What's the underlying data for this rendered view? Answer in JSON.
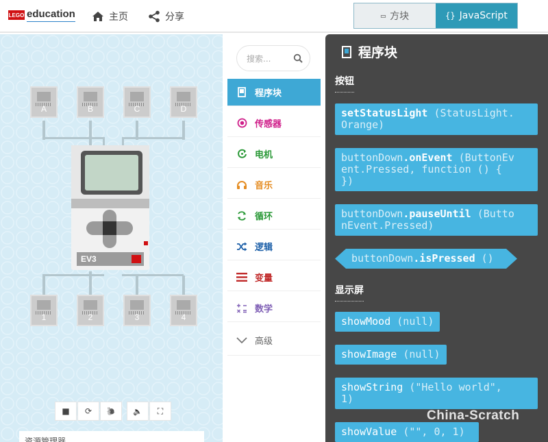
{
  "header": {
    "logo_badge": "LEGO",
    "logo_text": "education",
    "nav": [
      {
        "label": "主页",
        "icon": "home-icon"
      },
      {
        "label": "分享",
        "icon": "share-icon"
      }
    ],
    "mode_toggle": {
      "blocks_icon": "▭",
      "blocks_label": "方块",
      "js_icon": "{}",
      "js_label": "JavaScript",
      "active": "JavaScript"
    }
  },
  "simulator": {
    "input_ports": [
      "A",
      "B",
      "C",
      "D"
    ],
    "output_ports": [
      "1",
      "2",
      "3",
      "4"
    ],
    "brick_label": "EV3",
    "toolbar": [
      {
        "name": "stop",
        "glyph": "■"
      },
      {
        "name": "restart",
        "glyph": "⟳"
      },
      {
        "name": "slow-mo",
        "glyph": "🐌"
      },
      {
        "name": "mute",
        "glyph": "🔈"
      },
      {
        "name": "fullscreen",
        "glyph": "⛶"
      }
    ],
    "bottom_panel_text": "资源管理器"
  },
  "toolbox": {
    "search_placeholder": "搜索...",
    "categories": [
      {
        "label": "程序块",
        "color": "#3ea8d5"
      },
      {
        "label": "传感器",
        "color": "#cf1e89"
      },
      {
        "label": "电机",
        "color": "#2b9938"
      },
      {
        "label": "音乐",
        "color": "#e58d23"
      },
      {
        "label": "循环",
        "color": "#2b9938"
      },
      {
        "label": "逻辑",
        "color": "#1c5fa8"
      },
      {
        "label": "变量",
        "color": "#c02828"
      },
      {
        "label": "数学",
        "color": "#7f5fb5"
      },
      {
        "label": "高级",
        "color": "#666666"
      }
    ]
  },
  "flyout": {
    "title": "程序块",
    "sections": [
      {
        "label": "按钮"
      },
      {
        "label": "显示屏"
      }
    ],
    "blocks": [
      {
        "fn": "setStatusLight",
        "args": "(StatusLight.",
        "args2": "Orange)"
      },
      {
        "obj": "buttonDown",
        "fn": ".onEvent",
        "args": "(ButtonEv",
        "args2": "ent.Pressed, function () {",
        "args3": "})"
      },
      {
        "obj": "buttonDown",
        "fn": ".pauseUntil",
        "args": "(Butto",
        "args2": "nEvent.Pressed)"
      },
      {
        "obj": "buttonDown",
        "fn": ".isPressed",
        "args": "()"
      },
      {
        "fn": "showMood",
        "args": "(null)"
      },
      {
        "fn": "showImage",
        "args": "(null)"
      },
      {
        "fn": "showString",
        "args": "(\"Hello world\",",
        "args2": "1)"
      },
      {
        "fn": "showValue",
        "args": "(\"\", 0, 1)"
      }
    ],
    "watermark": "China-Scratch"
  },
  "colors": {
    "accent": "#3ea8d5",
    "block": "#47b5e1",
    "flyout_bg": "#474747"
  }
}
